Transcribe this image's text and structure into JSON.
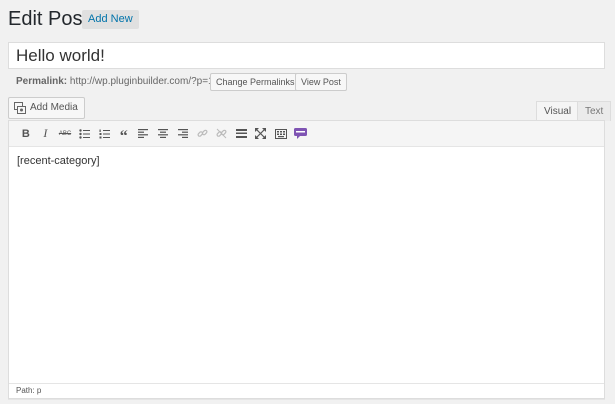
{
  "header": {
    "title": "Edit Post",
    "add_new_label": "Add New"
  },
  "post": {
    "title_value": "Hello world!"
  },
  "permalink": {
    "label": "Permalink:",
    "url": "http://wp.pluginbuilder.com/?p=1",
    "change_label": "Change Permalinks",
    "view_label": "View Post"
  },
  "media": {
    "add_media_label": "Add Media"
  },
  "tabs": [
    {
      "label": "Visual",
      "active": true
    },
    {
      "label": "Text",
      "active": false
    }
  ],
  "toolbar": {
    "bold_label": "B",
    "italic_label": "I",
    "strike_label": "ABC",
    "blockquote_label": "“",
    "buttons": [
      "bold-icon",
      "italic-icon",
      "strikethrough-icon",
      "bullet-list-icon",
      "numbered-list-icon",
      "blockquote-icon",
      "align-left-icon",
      "align-center-icon",
      "align-right-icon",
      "link-icon",
      "unlink-icon",
      "more-tag-icon",
      "fullscreen-icon",
      "kitchen-sink-icon",
      "woo-shortcode-icon"
    ],
    "woo_color": "#7f54b3"
  },
  "editor": {
    "content": "[recent-category]",
    "path_label": "Path: p"
  }
}
